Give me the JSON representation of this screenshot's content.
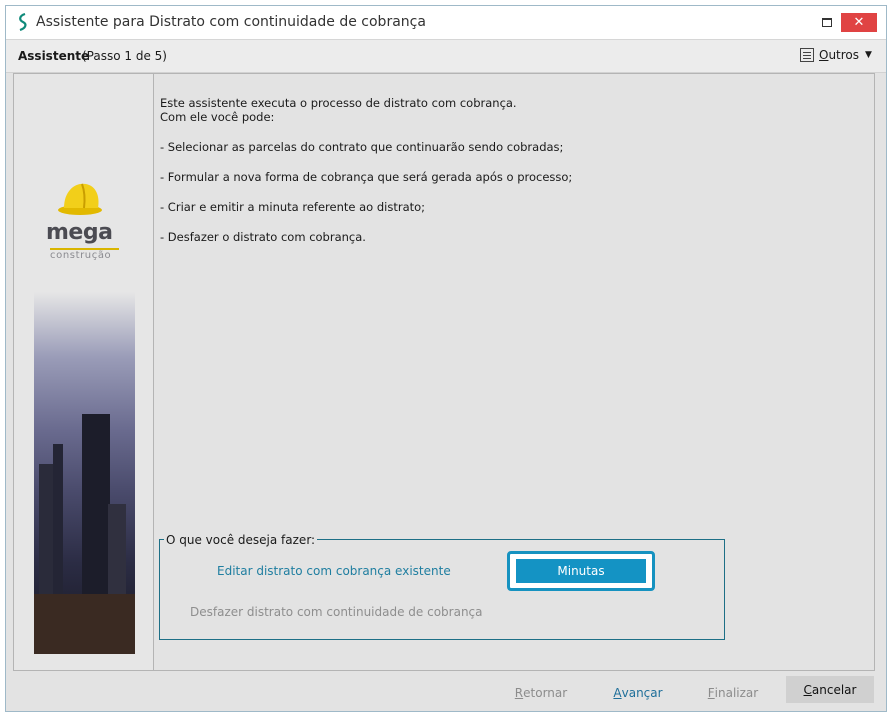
{
  "window": {
    "title": "Assistente para Distrato com continuidade de cobrança"
  },
  "header": {
    "wizard_label": "Assistente",
    "step_label": "(Passo 1 de 5)",
    "outros_prefix": "O",
    "outros_rest": "utros"
  },
  "sidebar": {
    "logo_text": "mega",
    "logo_subtext": "construção"
  },
  "content": {
    "lines": [
      "Este assistente executa o processo de distrato com cobrança.",
      "Com ele você pode:",
      "- Selecionar as parcelas do contrato que continuarão sendo cobradas;",
      "- Formular a nova forma de cobrança que será gerada após o processo;",
      "- Criar e emitir a minuta referente ao distrato;",
      "- Desfazer o distrato com cobrança."
    ]
  },
  "choices": {
    "legend": "O que você deseja fazer:",
    "edit_link": "Editar distrato com cobrança existente",
    "undo_link": "Desfazer distrato com continuidade de cobrança",
    "minutas_button": "Minutas"
  },
  "footer": {
    "back": {
      "mnemonic": "R",
      "rest": "etornar"
    },
    "next": {
      "mnemonic": "A",
      "rest": "vançar"
    },
    "finish": {
      "mnemonic": "F",
      "rest": "inalizar"
    },
    "cancel": {
      "mnemonic": "C",
      "rest": "ancelar"
    }
  },
  "colors": {
    "accent": "#1493c4",
    "link": "#1f7ea0",
    "close": "#e04343",
    "logo_gold": "#d9b500"
  }
}
